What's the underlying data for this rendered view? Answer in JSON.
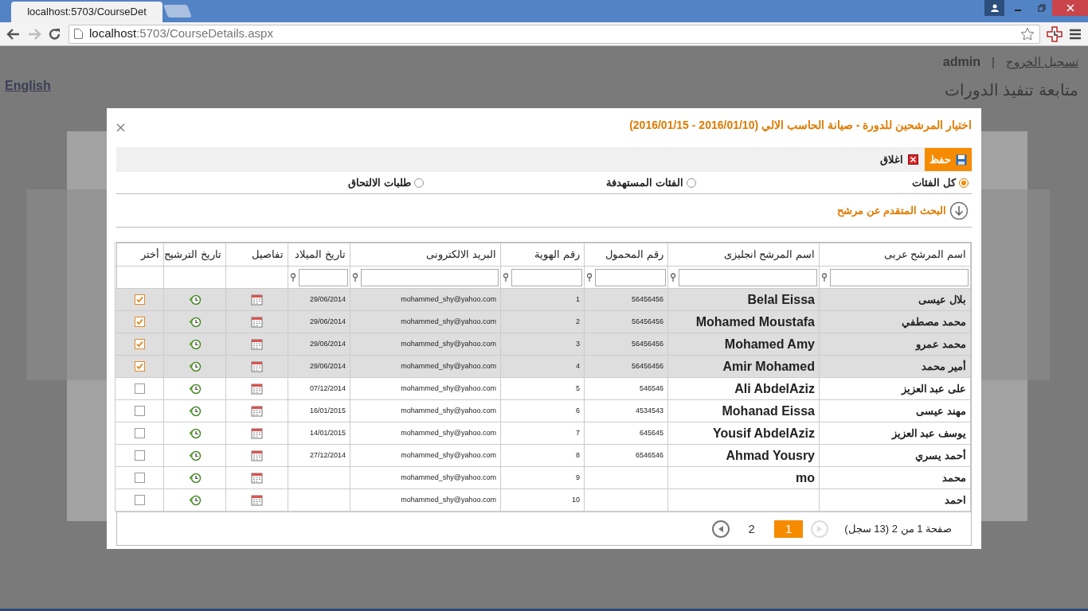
{
  "browser": {
    "tab_title": "localhost:5703/CourseDet",
    "url_host": "localhost",
    "url_path": ":5703/CourseDetails.aspx"
  },
  "page": {
    "language_link": "English",
    "user": "admin",
    "separator": "|",
    "logout": "تسجيل الخروج",
    "heading": "متابعة تنفيذ الدورات"
  },
  "dialog": {
    "title": "اختيار المرشحين للدورة - صيانة الحاسب الالي (2016/01/10 - 2016/01/15)",
    "toolbar": {
      "save": "حفظ",
      "close": "اغلاق"
    },
    "filters": [
      {
        "label": "كل الفئات",
        "selected": true
      },
      {
        "label": "الفئات المستهدفة",
        "selected": false
      },
      {
        "label": "طلبات الالتحاق",
        "selected": false
      }
    ],
    "advanced_search": "البحث المتقدم عن مرشح",
    "table": {
      "columns": [
        "اسم المرشح عربى",
        "اسم المرشح انجليزى",
        "رقم المحمول",
        "رقم الهوية",
        "البريد الالكترونى",
        "تاريخ الميلاد",
        "تفاصيل",
        "تاريخ الترشيح",
        "أختر"
      ],
      "rows": [
        {
          "name_ar": "بلال عيسى",
          "name_en": "Belal Eissa",
          "mobile": "56456456",
          "id": "1",
          "email": "mohammed_shy@yahoo.com",
          "birth_date": "29/06/2014",
          "selected": true,
          "checked": true
        },
        {
          "name_ar": "محمد مصطفي",
          "name_en": "Mohamed Moustafa",
          "mobile": "56456456",
          "id": "2",
          "email": "mohammed_shy@yahoo.com",
          "birth_date": "29/06/2014",
          "selected": true,
          "checked": true
        },
        {
          "name_ar": "محمد عمرو",
          "name_en": "Mohamed Amy",
          "mobile": "56456456",
          "id": "3",
          "email": "mohammed_shy@yahoo.com",
          "birth_date": "29/06/2014",
          "selected": true,
          "checked": true
        },
        {
          "name_ar": "أمير محمد",
          "name_en": "Amir Mohamed",
          "mobile": "56456456",
          "id": "4",
          "email": "mohammed_shy@yahoo.com",
          "birth_date": "29/06/2014",
          "selected": true,
          "checked": true
        },
        {
          "name_ar": "على عبد العزيز",
          "name_en": "Ali AbdelAziz",
          "mobile": "546546",
          "id": "5",
          "email": "mohammed_shy@yahoo.com",
          "birth_date": "07/12/2014",
          "selected": false,
          "checked": false
        },
        {
          "name_ar": "مهند عيسى",
          "name_en": "Mohanad Eissa",
          "mobile": "4534543",
          "id": "6",
          "email": "mohammed_shy@yahoo.com",
          "birth_date": "16/01/2015",
          "selected": false,
          "checked": false
        },
        {
          "name_ar": "يوسف عبد العزيز",
          "name_en": "Yousif AbdelAziz",
          "mobile": "645645",
          "id": "7",
          "email": "mohammed_shy@yahoo.com",
          "birth_date": "14/01/2015",
          "selected": false,
          "checked": false
        },
        {
          "name_ar": "أحمد يسري",
          "name_en": "Ahmad Yousry",
          "mobile": "6546546",
          "id": "8",
          "email": "mohammed_shy@yahoo.com",
          "birth_date": "27/12/2014",
          "selected": false,
          "checked": false
        },
        {
          "name_ar": "محمد",
          "name_en": "mo",
          "id": "9",
          "email": "mohammed_shy@yahoo.com",
          "selected": false,
          "checked": false
        },
        {
          "name_ar": "احمد",
          "id": "10",
          "email": "mohammed_shy@yahoo.com",
          "selected": false,
          "checked": false
        }
      ]
    },
    "pager": {
      "summary": "صفحة 1 من 2 (13 سجل)",
      "previous": {
        "disabled": true
      },
      "next": {
        "disabled": false
      },
      "pages": [
        {
          "label": "1",
          "selected": true
        },
        {
          "label": "2",
          "selected": false
        }
      ]
    }
  }
}
